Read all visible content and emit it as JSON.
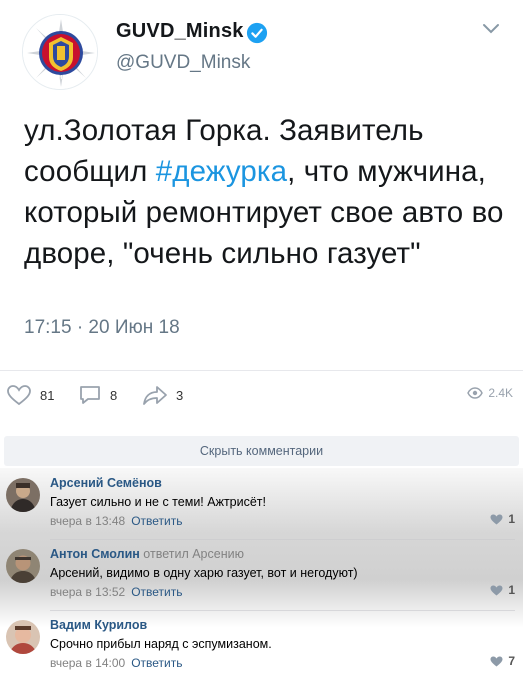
{
  "tweet": {
    "display_name": "GUVD_Minsk",
    "handle": "@GUVD_Minsk",
    "text_before": "ул.Золотая Горка. Заявитель сообщил ",
    "hashtag": "#дежурка",
    "text_after": ", что мужчина, который ремонтирует свое авто во дворе, \"очень сильно газует\"",
    "timestamp": "17:15 · 20 Июн 18",
    "logo_text": "МІНСК"
  },
  "post_actions": {
    "likes": "81",
    "comments": "8",
    "shares": "3",
    "views": "2.4K"
  },
  "comments_section": {
    "hide_label": "Скрыть комментарии",
    "items": [
      {
        "author": "Арсений Семёнов",
        "reply_to": "",
        "text": "Газует сильно и не с теми! Ажтрисёт!",
        "time": "вчера в 13:48",
        "reply_label": "Ответить",
        "likes": "1"
      },
      {
        "author": "Антон Смолин",
        "reply_to": "ответил Арсению",
        "text": "Арсений, видимо в одну харю газует, вот и негодуют)",
        "time": "вчера в 13:52",
        "reply_label": "Ответить",
        "likes": "1"
      },
      {
        "author": "Вадим Курилов",
        "reply_to": "",
        "text": "Срочно прибыл наряд с эспумизаном.",
        "time": "вчера в 14:00",
        "reply_label": "Ответить",
        "likes": "7"
      }
    ]
  },
  "colors": {
    "hashtag": "#1b95e0",
    "link": "#2a5885",
    "verified": "#1da1f2"
  },
  "icons": [
    "heart-icon",
    "comment-icon",
    "share-icon",
    "eye-icon",
    "verified-badge-icon",
    "chevron-down-icon"
  ]
}
